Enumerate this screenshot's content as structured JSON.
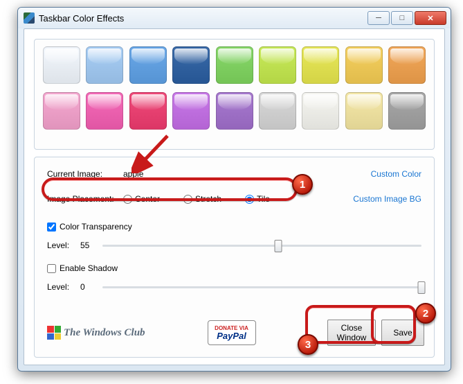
{
  "window": {
    "title": "Taskbar Color Effects"
  },
  "palette": {
    "row1": [
      "#f2f7fd",
      "#a8cef5",
      "#6aa8e8",
      "#3a6aa8",
      "#88d86a",
      "#c8ea5a",
      "#e8e85a",
      "#f5d060",
      "#f2a85a"
    ],
    "row2": [
      "#f5a8d0",
      "#f56ab8",
      "#f04a7a",
      "#c878e8",
      "#a87ad0",
      "#d8d8d8",
      "#f5f5f0",
      "#f5e8a8",
      "#a8a8a8"
    ]
  },
  "settings": {
    "current_image_label": "Current Image:",
    "current_image_value": "apple",
    "custom_color_link": "Custom Color",
    "placement_label": "Image Placement:",
    "placement_options": {
      "center": "Center",
      "stretch": "Stretch",
      "tile": "Tile"
    },
    "placement_selected": "tile",
    "custom_image_link": "Custom Image BG",
    "transparency_label": "Color Transparency",
    "transparency_checked": true,
    "transparency_level_label": "Level:",
    "transparency_level": "55",
    "transparency_slider_pct": 55,
    "shadow_label": "Enable Shadow",
    "shadow_checked": false,
    "shadow_level_label": "Level:",
    "shadow_level": "0",
    "shadow_slider_pct": 100
  },
  "footer": {
    "windows_club": "The Windows Club",
    "donate_via": "DONATE VIA",
    "paypal": "PayPal",
    "close_window": "Close\nWindow",
    "save": "Save"
  },
  "annotations": {
    "badge1": "1",
    "badge2": "2",
    "badge3": "3"
  }
}
